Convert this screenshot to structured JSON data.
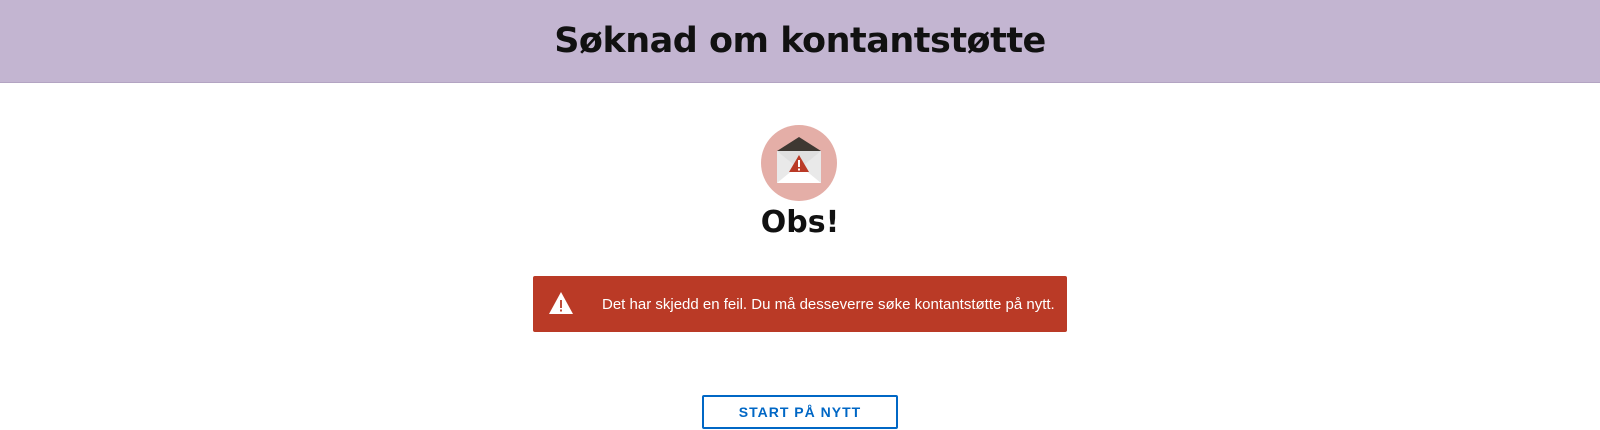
{
  "header": {
    "title": "Søknad om kontantstøtte"
  },
  "illustration": {
    "icon": "envelope-warning-icon",
    "circle_color": "#e4aea7"
  },
  "main": {
    "heading": "Obs!"
  },
  "alert": {
    "icon": "warning-triangle-icon",
    "message": "Det har skjedd en feil. Du må desseverre søke kontantstøtte på nytt.",
    "background": "#ba3a26"
  },
  "actions": {
    "restart_label": "START PÅ NYTT",
    "accent": "#0067c5"
  }
}
